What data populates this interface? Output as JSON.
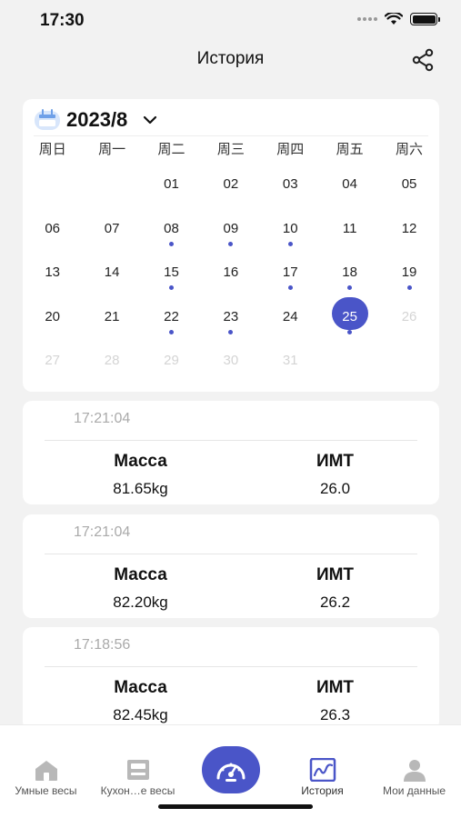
{
  "status_bar": {
    "time": "17:30"
  },
  "nav": {
    "title": "История"
  },
  "calendar": {
    "month": "2023/8",
    "weekdays": [
      "周日",
      "周一",
      "周二",
      "周三",
      "周四",
      "周五",
      "周六"
    ],
    "weeks": [
      [
        null,
        null,
        {
          "d": "01"
        },
        {
          "d": "02"
        },
        {
          "d": "03"
        },
        {
          "d": "04"
        },
        {
          "d": "05"
        }
      ],
      [
        {
          "d": "06"
        },
        {
          "d": "07"
        },
        {
          "d": "08",
          "dot": true
        },
        {
          "d": "09",
          "dot": true
        },
        {
          "d": "10",
          "dot": true
        },
        {
          "d": "11"
        },
        {
          "d": "12"
        }
      ],
      [
        {
          "d": "13"
        },
        {
          "d": "14"
        },
        {
          "d": "15",
          "dot": true
        },
        {
          "d": "16"
        },
        {
          "d": "17",
          "dot": true
        },
        {
          "d": "18",
          "dot": true
        },
        {
          "d": "19",
          "dot": true
        }
      ],
      [
        {
          "d": "20"
        },
        {
          "d": "21"
        },
        {
          "d": "22",
          "dot": true
        },
        {
          "d": "23",
          "dot": true
        },
        {
          "d": "24"
        },
        {
          "d": "25",
          "dot": true,
          "selected": true
        },
        {
          "d": "26",
          "faded": true
        }
      ],
      [
        {
          "d": "27",
          "faded": true
        },
        {
          "d": "28",
          "faded": true
        },
        {
          "d": "29",
          "faded": true
        },
        {
          "d": "30",
          "faded": true
        },
        {
          "d": "31",
          "faded": true
        },
        null,
        null
      ]
    ],
    "accent": "#4a55c8"
  },
  "records": [
    {
      "time": "17:21:04",
      "mass_label": "Масса",
      "mass": "81.65kg",
      "bmi_label": "ИМТ",
      "bmi": "26.0"
    },
    {
      "time": "17:21:04",
      "mass_label": "Масса",
      "mass": "82.20kg",
      "bmi_label": "ИМТ",
      "bmi": "26.2"
    },
    {
      "time": "17:18:56",
      "mass_label": "Масса",
      "mass": "82.45kg",
      "bmi_label": "ИМТ",
      "bmi": "26.3"
    }
  ],
  "tabbar": {
    "tabs": [
      {
        "label": "Умные весы",
        "icon": "house-icon"
      },
      {
        "label": "Кухон…е весы",
        "icon": "kitchen-scale-icon"
      },
      {
        "label": "",
        "icon": "gauge-icon"
      },
      {
        "label": "История",
        "icon": "chart-icon"
      },
      {
        "label": "Мои данные",
        "icon": "person-icon"
      }
    ]
  }
}
